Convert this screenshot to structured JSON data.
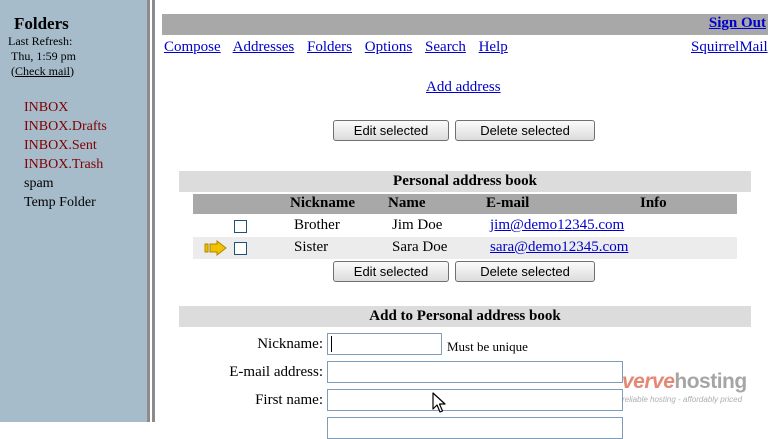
{
  "sidebar": {
    "title": "Folders",
    "refresh_label": "Last Refresh:",
    "refresh_time": "Thu, 1:59 pm",
    "check_mail_prefix": "(",
    "check_mail": "Check mail",
    "check_mail_suffix": ")",
    "folders": [
      {
        "label": "INBOX",
        "color": "#800000"
      },
      {
        "label": "INBOX.Drafts",
        "color": "#800000"
      },
      {
        "label": "INBOX.Sent",
        "color": "#800000"
      },
      {
        "label": "INBOX.Trash",
        "color": "#800000"
      },
      {
        "label": "spam",
        "color": "#000000"
      },
      {
        "label": "Temp Folder",
        "color": "#000000"
      }
    ]
  },
  "header": {
    "sign_out": "Sign Out",
    "nav": [
      "Compose",
      "Addresses",
      "Folders",
      "Options",
      "Search",
      "Help"
    ],
    "brand": "SquirrelMail"
  },
  "addresses": {
    "add_address_link": "Add address",
    "edit_selected": "Edit selected",
    "delete_selected": "Delete selected",
    "section_title": "Personal address book",
    "columns": [
      "Nickname",
      "Name",
      "E-mail",
      "Info"
    ],
    "rows": [
      {
        "nickname": "Brother",
        "name": "Jim Doe",
        "email": "jim@demo12345.com",
        "info": ""
      },
      {
        "nickname": "Sister",
        "name": "Sara Doe",
        "email": "sara@demo12345.com",
        "info": ""
      }
    ]
  },
  "add_form": {
    "section_title": "Add to Personal address book",
    "nickname_label": "Nickname:",
    "nickname_hint": "Must be unique",
    "email_label": "E-mail address:",
    "first_name_label": "First name:"
  },
  "watermark": {
    "brand_part1": "verve",
    "brand_part2": "hosting",
    "tagline": "reliable hosting - affordably priced"
  },
  "colors": {
    "sidebar_bg": "#a6bccb",
    "folder_red": "#800000",
    "link_blue": "#0000cc",
    "bar_gray": "#a8a8a8",
    "section_gray": "#dcdcdc"
  }
}
